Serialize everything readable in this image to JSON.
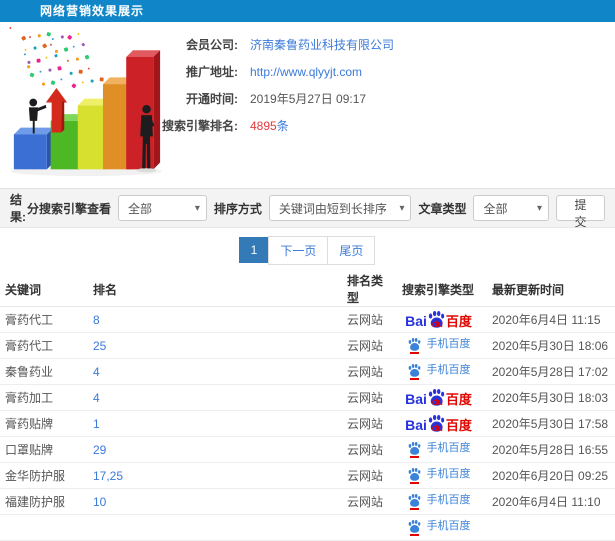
{
  "colors": {
    "header_blue": "#1086c8",
    "link_blue": "#3b7ad9",
    "accent_red": "#e4393c",
    "baidu_blue": "#2832dc",
    "baidu_red": "#e10601",
    "mobile_blue": "#3b82d9",
    "pagination_active": "#337ab7"
  },
  "header": {
    "title": "网络营销效果展示"
  },
  "info": {
    "rows": [
      {
        "label": "会员公司:",
        "value": "济南秦鲁药业科技有限公司",
        "style": "link"
      },
      {
        "label": "推广地址:",
        "value": "http://www.qlyyjt.com",
        "style": "link"
      },
      {
        "label": "开通时间:",
        "value": "2019年5月27日 09:17",
        "style": "plain"
      },
      {
        "label": "搜索引擎排名:",
        "value": "4895",
        "suffix": "条",
        "style": "highlight"
      }
    ]
  },
  "filters": {
    "section_label": "结果:",
    "engine_label": "分搜索引擎查看",
    "engine_value": "全部",
    "sort_label": "排序方式",
    "sort_value": "关键词由短到长排序",
    "article_label": "文章类型",
    "article_value": "全部",
    "submit_label": "提交"
  },
  "pagination": {
    "current": "1",
    "next_label": "下一页",
    "last_label": "尾页"
  },
  "table": {
    "headers": [
      "关键词",
      "排名",
      "排名类型",
      "搜索引擎类型",
      "最新更新时间"
    ],
    "rows": [
      {
        "keyword": "膏药代工",
        "rank": "8",
        "rank_type": "云网站",
        "engine": "baidu_pc",
        "updated": "2020年6月4日 11:15"
      },
      {
        "keyword": "膏药代工",
        "rank": "25",
        "rank_type": "云网站",
        "engine": "baidu_mobile",
        "updated": "2020年5月30日 18:06"
      },
      {
        "keyword": "秦鲁药业",
        "rank": "4",
        "rank_type": "云网站",
        "engine": "baidu_mobile",
        "updated": "2020年5月28日 17:02"
      },
      {
        "keyword": "膏药加工",
        "rank": "4",
        "rank_type": "云网站",
        "engine": "baidu_pc",
        "updated": "2020年5月30日 18:03"
      },
      {
        "keyword": "膏药贴牌",
        "rank": "1",
        "rank_type": "云网站",
        "engine": "baidu_pc",
        "updated": "2020年5月30日 17:58"
      },
      {
        "keyword": "口罩贴牌",
        "rank": "29",
        "rank_type": "云网站",
        "engine": "baidu_mobile",
        "updated": "2020年5月28日 16:55"
      },
      {
        "keyword": "金华防护服",
        "rank": "17,25",
        "rank_type": "云网站",
        "engine": "baidu_mobile",
        "updated": "2020年6月20日 09:25"
      },
      {
        "keyword": "福建防护服",
        "rank": "10",
        "rank_type": "云网站",
        "engine": "baidu_mobile",
        "updated": "2020年6月4日 11:10"
      },
      {
        "keyword": "",
        "rank": "",
        "rank_type": "",
        "engine": "baidu_mobile",
        "updated": ""
      }
    ]
  },
  "engines": {
    "baidu_pc": {
      "text_bai": "Bai",
      "text_du": "du",
      "text_cn": "百度"
    },
    "baidu_mobile": {
      "label": "手机百度"
    }
  }
}
